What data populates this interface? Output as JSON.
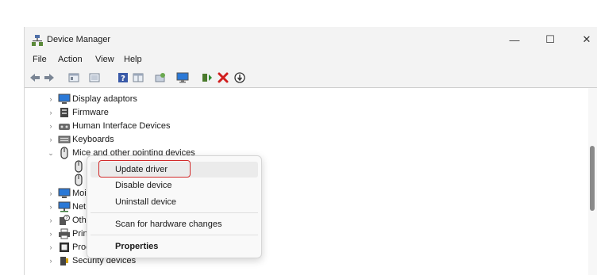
{
  "window": {
    "title": "Device Manager",
    "controls": {
      "minimize": "—",
      "maximize": "☐",
      "close": "✕"
    }
  },
  "menu": [
    "File",
    "Action",
    "View",
    "Help"
  ],
  "toolbar_icons": [
    "back-arrow-icon",
    "forward-arrow-icon",
    "properties-icon",
    "show-hidden-icon",
    "help-icon",
    "grid-icon",
    "scan-icon",
    "monitor-icon",
    "driver-update-icon",
    "uninstall-icon",
    "disable-icon"
  ],
  "tree": {
    "items": [
      {
        "label": "Display adaptors",
        "icon": "display-icon",
        "expanded": false
      },
      {
        "label": "Firmware",
        "icon": "firmware-icon",
        "expanded": false
      },
      {
        "label": "Human Interface Devices",
        "icon": "hid-icon",
        "expanded": false
      },
      {
        "label": "Keyboards",
        "icon": "keyboard-icon",
        "expanded": false
      },
      {
        "label": "Mice and other pointing devices",
        "icon": "mouse-icon",
        "expanded": true
      },
      {
        "label": "",
        "icon": "mouse-icon",
        "child": true
      },
      {
        "label": "",
        "icon": "mouse-icon",
        "child": true
      },
      {
        "label": "Moi",
        "icon": "monitor-icon",
        "expanded": false
      },
      {
        "label": "Net",
        "icon": "network-icon",
        "expanded": false
      },
      {
        "label": "Oth",
        "icon": "other-icon",
        "expanded": false
      },
      {
        "label": "Prin",
        "icon": "printer-icon",
        "expanded": false
      },
      {
        "label": "Proc",
        "icon": "processor-icon",
        "expanded": false
      },
      {
        "label": "Security devices",
        "icon": "security-icon",
        "expanded": false
      }
    ]
  },
  "context_menu": {
    "items": [
      "Update driver",
      "Disable device",
      "Uninstall device",
      "Scan for hardware changes",
      "Properties"
    ]
  },
  "colors": {
    "highlight_border": "#d22a2a",
    "accent_blue": "#2b79d7",
    "uninstall_red": "#d11f1f"
  }
}
